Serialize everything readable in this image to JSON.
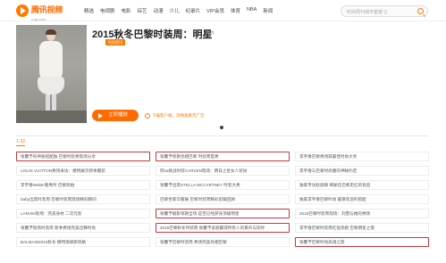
{
  "logo": {
    "text": "腾讯视频",
    "sub": "v.qq.com"
  },
  "nav": [
    "精选",
    "电视剧",
    "电影",
    "综艺",
    "动漫",
    "少儿",
    "纪录片",
    "VIP会员",
    "体育",
    "NBA",
    "新闻"
  ],
  "search": {
    "placeholder": "时尚周刊城市套装 Q"
  },
  "video": {
    "title": "2015秋冬巴黎时装周：明星",
    "date": "· 时尚",
    "tag": "时尚资讯",
    "play_label": "立即播放",
    "download_label": "下载客户端，流畅观看无广告"
  },
  "episodes": {
    "range_label": "1-32",
    "items": [
      {
        "text": "张馨予的神秘搭配独 巴黎时装秀现场分享",
        "highlight": true
      },
      {
        "text": "张馨予惊艳亮相巴黎 时装周首秀",
        "highlight": true
      },
      {
        "text": "李宇春巴黎秀场获最佳时尚大奖",
        "highlight": false
      },
      {
        "text": "LOUIS VUITTON秀场采访：模特展示新季服装",
        "highlight": false
      },
      {
        "text": "阿sa挑战时装CARVEN现场：明日之星女人装扮",
        "highlight": false
      },
      {
        "text": "李宇春与巴黎时尚圈的神秘约定",
        "highlight": false
      },
      {
        "text": "李宇春Walter看秀时 巴黎街拍",
        "highlight": false
      },
      {
        "text": "张馨予出席STELLA MCCARTNEY 时装大秀",
        "highlight": false
      },
      {
        "text": "独家专访赵丽颖 揭秘在巴黎走红的背后",
        "highlight": false
      },
      {
        "text": "baby出席时装周 巴黎时装周现场精彩瞬间",
        "highlight": false
      },
      {
        "text": "巴黎世家华服展 巴黎时装周精彩剪辑回顾",
        "highlight": false
      },
      {
        "text": "独家李宇春巴黎时尚 最受欢迎的搭配",
        "highlight": false
      },
      {
        "text": "LANVIN现场：完美身材 二次元装",
        "highlight": false
      },
      {
        "text": "张馨予魅影惊艳全场 是否已经跻身顶级明星",
        "highlight": true
      },
      {
        "text": "2015巴黎时装周现场：刘雯与她的秀场",
        "highlight": false
      },
      {
        "text": "张馨予现场时装周 新季秀场完美诠释时尚",
        "highlight": false
      },
      {
        "text": "2015巴黎秋冬时装周 张馨予美貌赢得所有人的掌声与欢呼",
        "highlight": true
      },
      {
        "text": "李宇春巴黎时装周红毯亮相 巴黎明星之夜",
        "highlight": false
      },
      {
        "text": "BALMAIN2015秋冬 模特演绎新风格",
        "highlight": false
      },
      {
        "text": "张馨予巴黎时装周 秀场完美亮相巴黎",
        "highlight": false
      },
      {
        "text": "张馨予巴黎时尚高调之旅",
        "highlight": true
      }
    ]
  }
}
